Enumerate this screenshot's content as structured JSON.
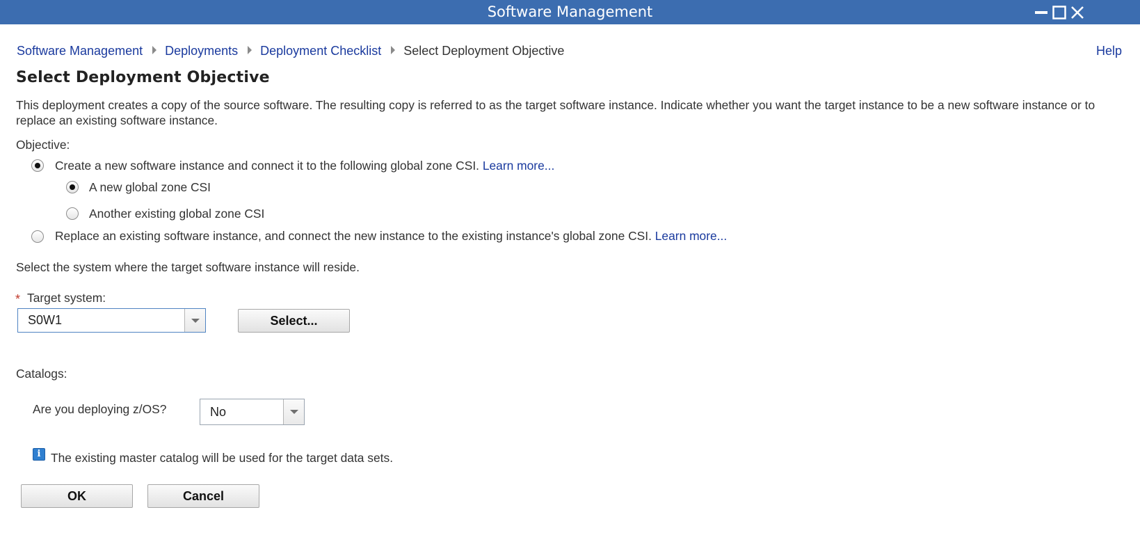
{
  "window": {
    "title": "Software Management"
  },
  "breadcrumb": {
    "items": [
      "Software Management",
      "Deployments",
      "Deployment Checklist"
    ],
    "current": "Select Deployment Objective"
  },
  "help_label": "Help",
  "page_title": "Select Deployment Objective",
  "description": "This deployment creates a copy of the source software. The resulting copy is referred to as the target software instance. Indicate whether you want the target instance to be a new software instance or to replace an existing software instance.",
  "objective": {
    "label": "Objective:",
    "option_create": {
      "label": "Create a new software instance and connect it to the following global zone CSI.",
      "learn_more": "Learn more...",
      "selected": true
    },
    "sub_new_csi": {
      "label": "A new global zone CSI",
      "selected": true
    },
    "sub_existing_csi": {
      "label": "Another existing global zone CSI",
      "selected": false
    },
    "option_replace": {
      "label": "Replace an existing software instance, and connect the new instance to the existing instance's global zone CSI.",
      "learn_more": "Learn more...",
      "selected": false
    }
  },
  "system_prompt": "Select the system where the target software instance will reside.",
  "target_system": {
    "required_mark": "*",
    "label": "Target system:",
    "value": "S0W1",
    "select_button": "Select..."
  },
  "catalogs": {
    "label": "Catalogs:",
    "zos_question": "Are you deploying z/OS?",
    "zos_value": "No",
    "info_text": "The existing master catalog will be used for the target data sets."
  },
  "buttons": {
    "ok": "OK",
    "cancel": "Cancel"
  },
  "colors": {
    "titlebar": "#3c6db0",
    "link": "#1a3a9e",
    "required": "#c0392b",
    "info": "#2f7fd0"
  }
}
